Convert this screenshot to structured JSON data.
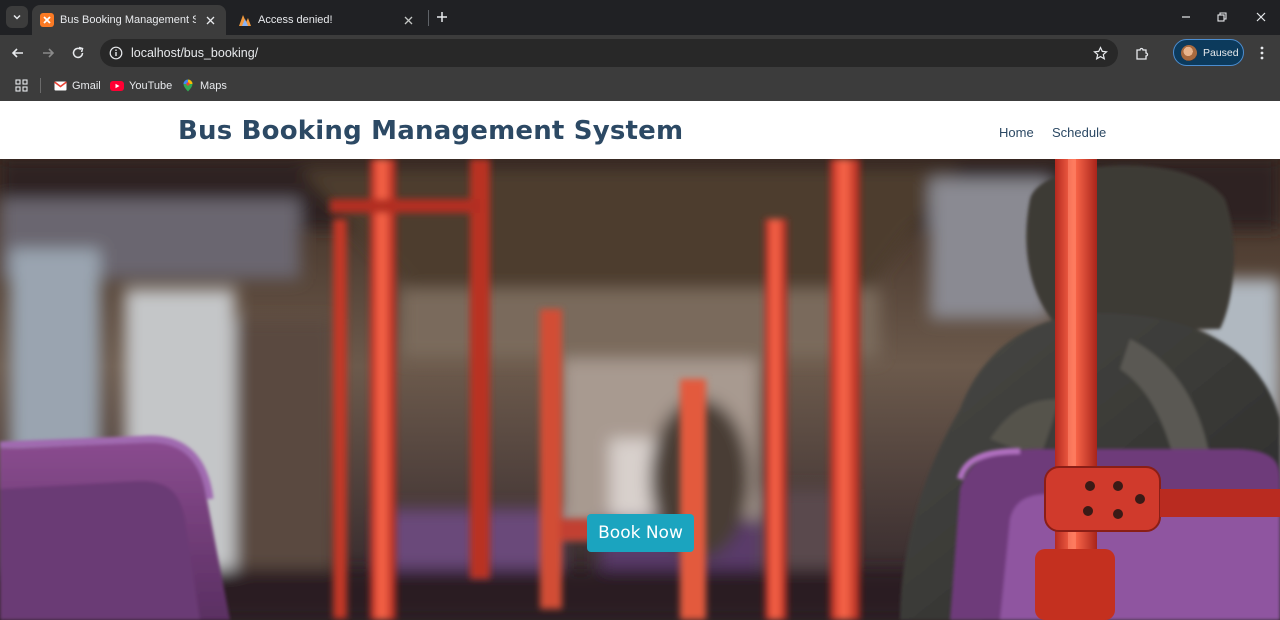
{
  "browser": {
    "tabs": [
      {
        "title": "Bus Booking Management System",
        "active": true
      },
      {
        "title": "Access denied!",
        "active": false
      }
    ],
    "address": "localhost/bus_booking/",
    "profile_label": "Paused",
    "bookmarks": [
      {
        "label": "Gmail",
        "icon": "gmail-icon"
      },
      {
        "label": "YouTube",
        "icon": "youtube-icon"
      },
      {
        "label": "Maps",
        "icon": "maps-icon"
      }
    ]
  },
  "site": {
    "brand": "Bus Booking Management System",
    "nav": [
      {
        "label": "Home"
      },
      {
        "label": "Schedule"
      }
    ],
    "hero_button": "Book Now",
    "hero_image": "bus interior with red grab poles, purple seats and a passenger in a hooded jacket"
  },
  "colors": {
    "brand_text": "#2c4964",
    "button": "#1ba4bf",
    "toolbar": "#3c3c3c",
    "tabstrip": "#202124"
  }
}
